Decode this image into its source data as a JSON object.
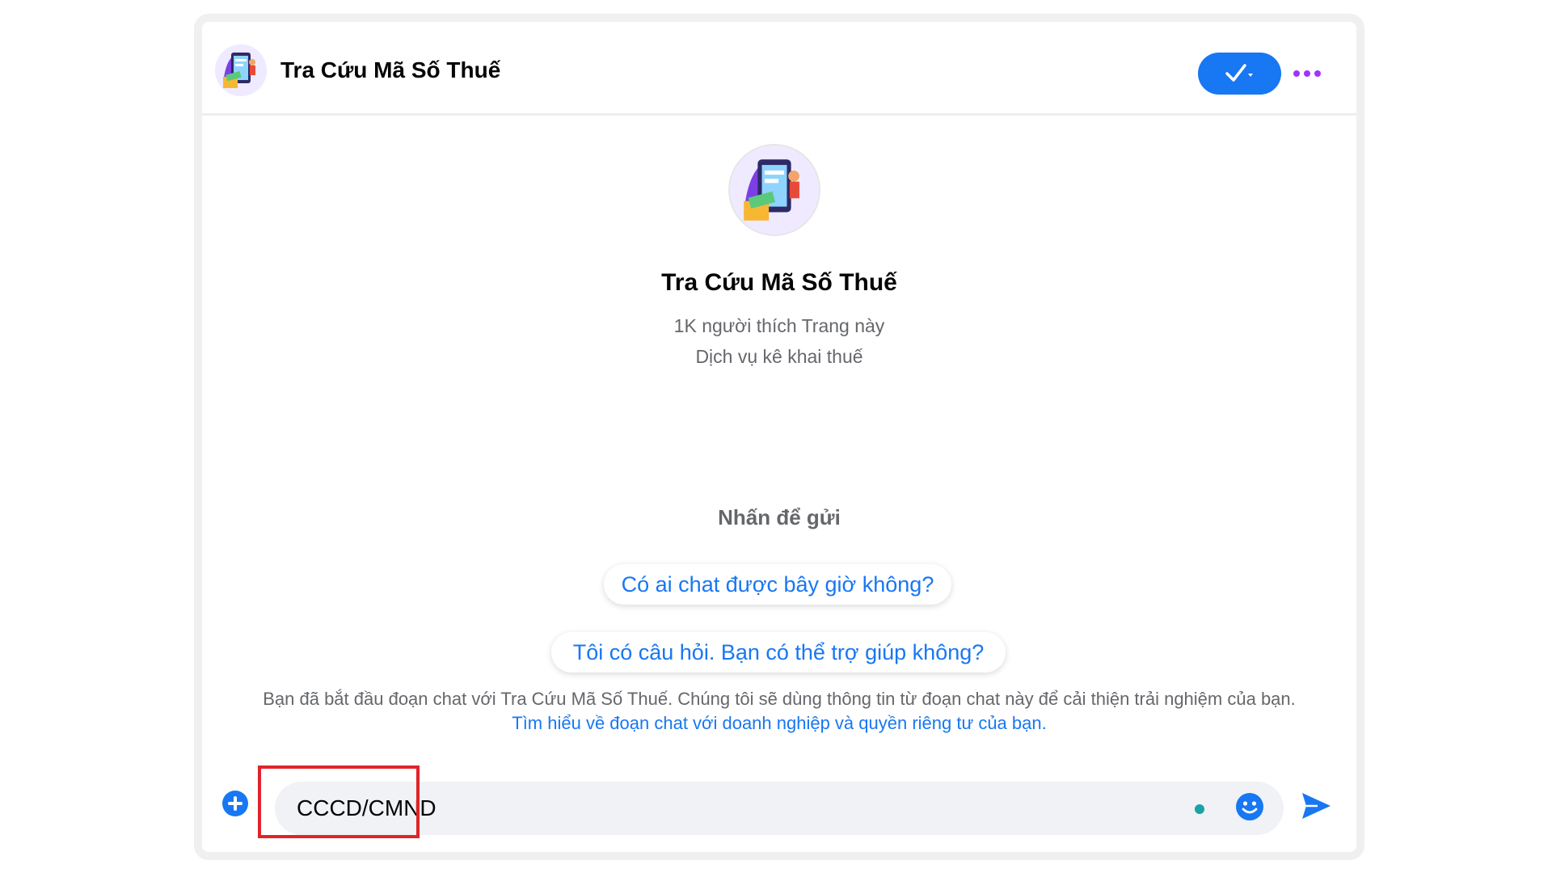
{
  "header": {
    "title": "Tra Cứu Mã Số Thuế",
    "verified_icon": "check-dropdown-icon",
    "more_icon": "more-dots-icon"
  },
  "profile": {
    "name": "Tra Cứu Mã Số Thuế",
    "likes": "1K người thích Trang này",
    "category": "Dịch vụ kê khai thuế"
  },
  "quick_replies": {
    "label": "Nhấn để gửi",
    "items": [
      "Có ai chat được bây giờ không?",
      "Tôi có câu hỏi. Bạn có thể trợ giúp không?"
    ]
  },
  "disclaimer": {
    "text": "Bạn đã bắt đầu đoạn chat với Tra Cứu Mã Số Thuế. Chúng tôi sẽ dùng thông tin từ đoạn chat này để cải thiện trải nghiệm của bạn.",
    "link": "Tìm hiểu về đoạn chat với doanh nghiệp và quyền riêng tư của bạn."
  },
  "composer": {
    "value": "CCCD/CMND"
  },
  "colors": {
    "accent": "#1877f2",
    "more_dots": "#a033ff",
    "highlight": "#e0242a"
  }
}
